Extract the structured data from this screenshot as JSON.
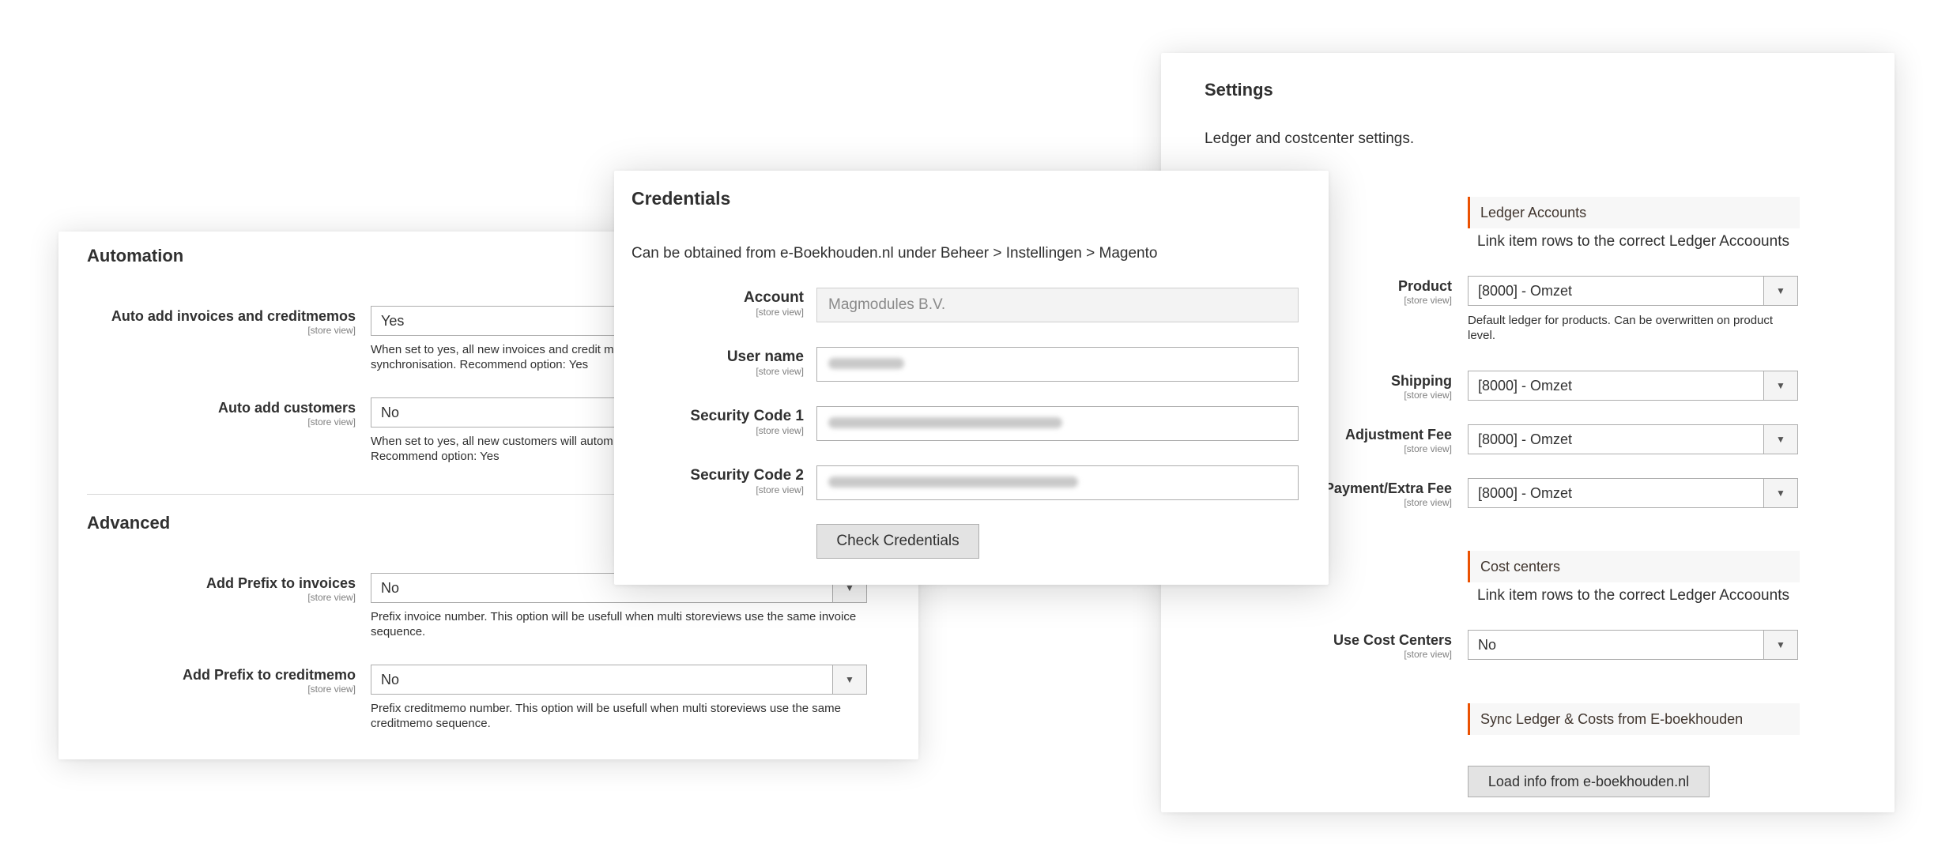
{
  "automation": {
    "title": "Automation",
    "fields": [
      {
        "label": "Auto add invoices and creditmemos",
        "scope": "[store view]",
        "value": "Yes",
        "note_lines": [
          "When set to yes, all new invoices and credit me",
          "synchronisation. Recommend option: Yes"
        ]
      },
      {
        "label": "Auto add customers",
        "scope": "[store view]",
        "value": "No",
        "note_lines": [
          "When set to yes, all new customers will autom",
          "Recommend option: Yes"
        ]
      }
    ]
  },
  "advanced": {
    "title": "Advanced",
    "fields": [
      {
        "label": "Add Prefix to invoices",
        "scope": "[store view]",
        "value": "No",
        "note_lines": [
          "Prefix invoice number. This option will be usefull when multi storeviews use the same invoice",
          "sequence."
        ]
      },
      {
        "label": "Add Prefix to creditmemo",
        "scope": "[store view]",
        "value": "No",
        "note_lines": [
          "Prefix creditmemo number. This option will be usefull when multi storeviews use the same",
          "creditmemo sequence."
        ]
      }
    ]
  },
  "credentials": {
    "title": "Credentials",
    "description": "Can be obtained from e-Boekhouden.nl under Beheer > Instellingen > Magento",
    "fields": [
      {
        "label": "Account",
        "scope": "[store view]",
        "value": "Magmodules B.V."
      },
      {
        "label": "User name",
        "scope": "[store view]",
        "value": ""
      },
      {
        "label": "Security Code 1",
        "scope": "[store view]",
        "value": ""
      },
      {
        "label": "Security Code 2",
        "scope": "[store view]",
        "value": ""
      }
    ],
    "check_button": "Check Credentials"
  },
  "settings": {
    "title": "Settings",
    "description": "Ledger and costcenter settings.",
    "ledger_header": "Ledger Accounts",
    "ledger_subnote": "Link item rows to the correct Ledger Accoounts",
    "ledger_fields": [
      {
        "label": "Product",
        "scope": "[store view]",
        "value": "[8000] - Omzet",
        "note_lines": [
          "Default ledger for products. Can be overwritten on product",
          "level."
        ]
      },
      {
        "label": "Shipping",
        "scope": "[store view]",
        "value": "[8000] - Omzet"
      },
      {
        "label": "Adjustment Fee",
        "scope": "[store view]",
        "value": "[8000] - Omzet"
      },
      {
        "label": "Payment/Extra Fee",
        "scope": "[store view]",
        "value": "[8000] - Omzet"
      }
    ],
    "cost_header": "Cost centers",
    "cost_subnote": "Link item rows to the correct Ledger Accoounts",
    "cost_field": {
      "label": "Use Cost Centers",
      "scope": "[store view]",
      "value": "No"
    },
    "sync_header": "Sync Ledger & Costs from E-boekhouden",
    "load_button": "Load info from e-boekhouden.nl"
  },
  "icons": {
    "dropdown": "triangle-down-icon"
  },
  "colors": {
    "accent": "#eb5202"
  }
}
